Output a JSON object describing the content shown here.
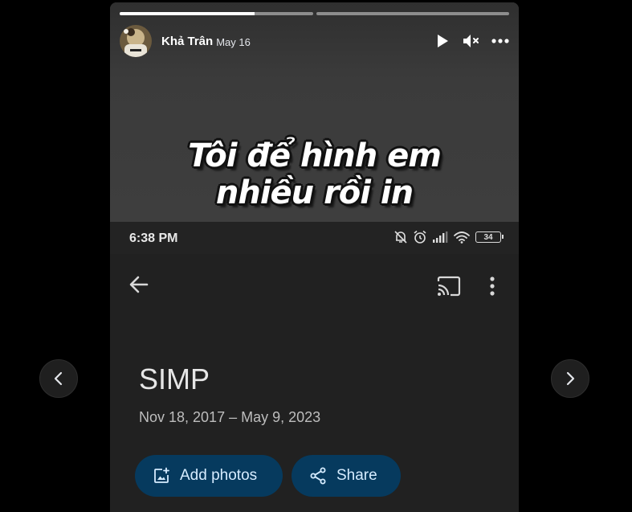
{
  "story": {
    "author": "Khả Trân",
    "date": "May 16",
    "progress": [
      0.7,
      0.0
    ],
    "caption_line1": "Tôi để hình em",
    "caption_line2": "nhiều rồi in"
  },
  "controls": {
    "play_icon": "play-icon",
    "mute_icon": "muted-speaker-icon",
    "more_icon": "more-horizontal-icon"
  },
  "phone": {
    "time": "6:38 PM",
    "battery": "34",
    "album_title": "SIMP",
    "album_range": "Nov 18, 2017 – May 9, 2023",
    "add_photos_label": "Add photos",
    "share_label": "Share"
  },
  "navigation": {
    "prev_icon": "chevron-left-icon",
    "next_icon": "chevron-right-icon"
  },
  "colors": {
    "pill_bg": "#063a5e",
    "pill_text": "#d6ecff",
    "phone_bg": "#212121"
  }
}
